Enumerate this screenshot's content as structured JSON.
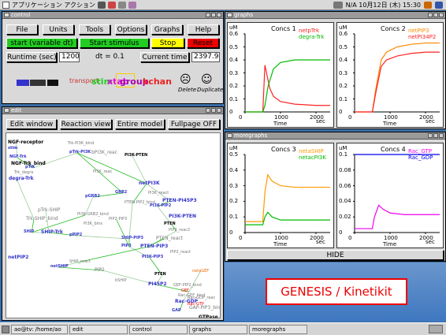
{
  "top_panel": {
    "menu_label": "アプリケーション アクション",
    "status_text": "N/A 10月12日 (木) 15:30"
  },
  "control": {
    "title": "control",
    "menu": [
      "File",
      "Units",
      "Tools",
      "Options",
      "Graphs",
      "Help"
    ],
    "start_label": "start (variable dt)",
    "stim_label": "Start stimulus",
    "stop_label": "Stop",
    "reset_label": "Reset",
    "runtime_label": "Runtime (sec)",
    "runtime_value": "1200",
    "dt_label": "dt = 0.1",
    "current_time_label": "Current time",
    "current_time_value": "2397.9",
    "palette_labels": [
      "kpool",
      "kreac",
      "kenz",
      "stim",
      "xtab",
      "group",
      "kchan",
      "transport"
    ],
    "palette_delete": "Delete",
    "palette_duplicate": "Duplicate",
    "colors": {
      "start": "#22cc22",
      "stim": "#22cc22",
      "stop": "#ffff00",
      "reset": "#ee0000"
    }
  },
  "edit": {
    "title": "edit",
    "tabs": [
      "Edit window",
      "Reaction view",
      "Entire model",
      "Fullpage OFF"
    ],
    "nodes": [
      "NGF-receptor",
      "stim",
      "NGF-Trk",
      "NGF-Trk_bind",
      "pTrk",
      "Trk_degra",
      "degra-Trk",
      "Trk-PI3K_bind",
      "pTrk-PI3K",
      "bPI3K_reac",
      "PI3K-PTEN",
      "PI3K_reac",
      "netPI3K",
      "GRB2",
      "PI3K_react",
      "PTEN-PI45P3",
      "pGRB2",
      "PTEN-PIP2_bind",
      "pTrk-SHIP",
      "PI3K-PIP2",
      "PI3K-GRB2_bind",
      "PI3K-PTEN",
      "PIP2-PIP3",
      "PTEN",
      "Trk-SHIP_bind",
      "PI3K_binx",
      "SHIP",
      "SHIP-Trk",
      "pPIP2",
      "PIP2_reac2",
      "PTEN_react",
      "SHIP-PIP3",
      "PIP3",
      "PTEN-PIP3",
      "PIP2_react",
      "PI3K-PIP3",
      "netPIP2",
      "SHIP_react",
      "netSHIP",
      "PIP2",
      "netaGEF",
      "PTEN",
      "PI45P2",
      "bSHIP",
      "GEF",
      "Rac-GDP",
      "Rac-GTP",
      "GAP",
      "GTPase",
      "Rac-GEF_bind",
      "Rac-GDP_reac",
      "GAP-PIP3_bind",
      "GEF-PIP2_bind"
    ]
  },
  "graphs": {
    "title": "graphs",
    "charts": [
      {
        "unit": "uM",
        "title": "Concs 1",
        "legend": [
          "netpTrk",
          "degra-Trk"
        ],
        "legend_colors": [
          "#ff2222",
          "#00bb00"
        ],
        "y_ticks": [
          "0.6",
          "0.5",
          "0.4",
          "0.3",
          "0.2",
          "0.1",
          "0"
        ],
        "x_ticks": [
          "0",
          "1000",
          "2000"
        ],
        "xlabel": "Time",
        "xunit": "sec"
      },
      {
        "unit": "uM",
        "title": "Concs 2",
        "legend": [
          "netPIP3",
          "netPI34P2"
        ],
        "legend_colors": [
          "#ff8800",
          "#ff2222"
        ],
        "y_ticks": [
          "0.6",
          "0.5",
          "0.4",
          "0.3",
          "0.2",
          "0.1",
          "0"
        ],
        "x_ticks": [
          "0",
          "1000",
          "2000"
        ],
        "xlabel": "Time",
        "xunit": "sec"
      }
    ]
  },
  "moregraphs": {
    "title": "moregraphs",
    "charts": [
      {
        "unit": "uM",
        "title": "Concs 3",
        "legend": [
          "netaSHIP",
          "netacPI3K"
        ],
        "legend_colors": [
          "#ff9900",
          "#00bb00"
        ],
        "y_ticks": [
          "0.5",
          "0.4",
          "0.3",
          "0.2",
          "0.1",
          "0"
        ],
        "x_ticks": [
          "0",
          "1000",
          "2000"
        ],
        "xlabel": "Time",
        "xunit": "sec"
      },
      {
        "unit": "uM",
        "title": "Concs 4",
        "legend": [
          "Rac_GTP",
          "Rac_GDP"
        ],
        "legend_colors": [
          "#ee00ee",
          "#0000ee"
        ],
        "y_ticks": [
          "0.1",
          "0.08",
          "0.06",
          "0.04",
          "0.02",
          "0"
        ],
        "x_ticks": [
          "0",
          "1000",
          "2000"
        ],
        "xlabel": "Time",
        "xunit": "sec"
      }
    ],
    "hide_label": "HIDE"
  },
  "banner": {
    "text": "GENESIS / Kinetikit",
    "color": "#ee0000"
  },
  "taskbar": {
    "items": [
      "ao@tv: /home/ao",
      "edit",
      "control",
      "graphs",
      "moregraphs"
    ]
  },
  "chart_data": [
    {
      "type": "line",
      "title": "Concs 1",
      "ylabel": "uM",
      "xlabel": "Time",
      "xlim": [
        0,
        2400
      ],
      "ylim": [
        0,
        0.6
      ],
      "grid": false,
      "legend_position": "top-right",
      "series": [
        {
          "name": "netpTrk",
          "color": "#ff2222",
          "x": [
            0,
            500,
            560,
            620,
            700,
            800,
            1000,
            1400,
            2000,
            2400
          ],
          "y": [
            0,
            0,
            0.36,
            0.28,
            0.18,
            0.12,
            0.08,
            0.06,
            0.05,
            0.05
          ]
        },
        {
          "name": "degra-Trk",
          "color": "#00bb00",
          "x": [
            0,
            500,
            560,
            650,
            800,
            1000,
            1400,
            2000,
            2400
          ],
          "y": [
            0,
            0,
            0.05,
            0.2,
            0.33,
            0.38,
            0.4,
            0.4,
            0.4
          ]
        }
      ]
    },
    {
      "type": "line",
      "title": "Concs 2",
      "ylabel": "uM",
      "xlabel": "Time",
      "xlim": [
        0,
        2400
      ],
      "ylim": [
        0,
        0.6
      ],
      "grid": false,
      "legend_position": "top-right",
      "series": [
        {
          "name": "netPIP3",
          "color": "#ff8800",
          "x": [
            0,
            500,
            600,
            750,
            900,
            1200,
            1600,
            2000,
            2400
          ],
          "y": [
            0,
            0,
            0.18,
            0.4,
            0.46,
            0.5,
            0.52,
            0.53,
            0.53
          ]
        },
        {
          "name": "netPI34P2",
          "color": "#ff2222",
          "x": [
            0,
            500,
            600,
            750,
            900,
            1200,
            1600,
            2000,
            2400
          ],
          "y": [
            0,
            0,
            0.15,
            0.35,
            0.4,
            0.43,
            0.45,
            0.46,
            0.46
          ]
        }
      ]
    },
    {
      "type": "line",
      "title": "Concs 3",
      "ylabel": "uM",
      "xlabel": "Time",
      "xlim": [
        0,
        2400
      ],
      "ylim": [
        0,
        0.5
      ],
      "grid": false,
      "legend_position": "top-right",
      "series": [
        {
          "name": "netaSHIP",
          "color": "#ff9900",
          "x": [
            0,
            500,
            560,
            640,
            760,
            1000,
            1400,
            2000,
            2400
          ],
          "y": [
            0.07,
            0.07,
            0.26,
            0.37,
            0.33,
            0.3,
            0.29,
            0.29,
            0.29
          ]
        },
        {
          "name": "netacPI3K",
          "color": "#00bb00",
          "x": [
            0,
            500,
            560,
            640,
            760,
            1000,
            1400,
            2000,
            2400
          ],
          "y": [
            0.05,
            0.05,
            0.1,
            0.13,
            0.1,
            0.08,
            0.08,
            0.08,
            0.08
          ]
        }
      ]
    },
    {
      "type": "line",
      "title": "Concs 4",
      "ylabel": "uM",
      "xlabel": "Time",
      "xlim": [
        0,
        2400
      ],
      "ylim": [
        0,
        0.1
      ],
      "grid": false,
      "legend_position": "top-right",
      "series": [
        {
          "name": "Rac_GTP",
          "color": "#ee00ee",
          "x": [
            0,
            500,
            560,
            680,
            800,
            1000,
            1400,
            2000,
            2400
          ],
          "y": [
            0.005,
            0.005,
            0.02,
            0.035,
            0.03,
            0.025,
            0.023,
            0.023,
            0.023
          ]
        },
        {
          "name": "Rac_GDP",
          "color": "#0000ee",
          "x": [
            0,
            2400
          ],
          "y": [
            0.1,
            0.1
          ]
        }
      ]
    }
  ]
}
